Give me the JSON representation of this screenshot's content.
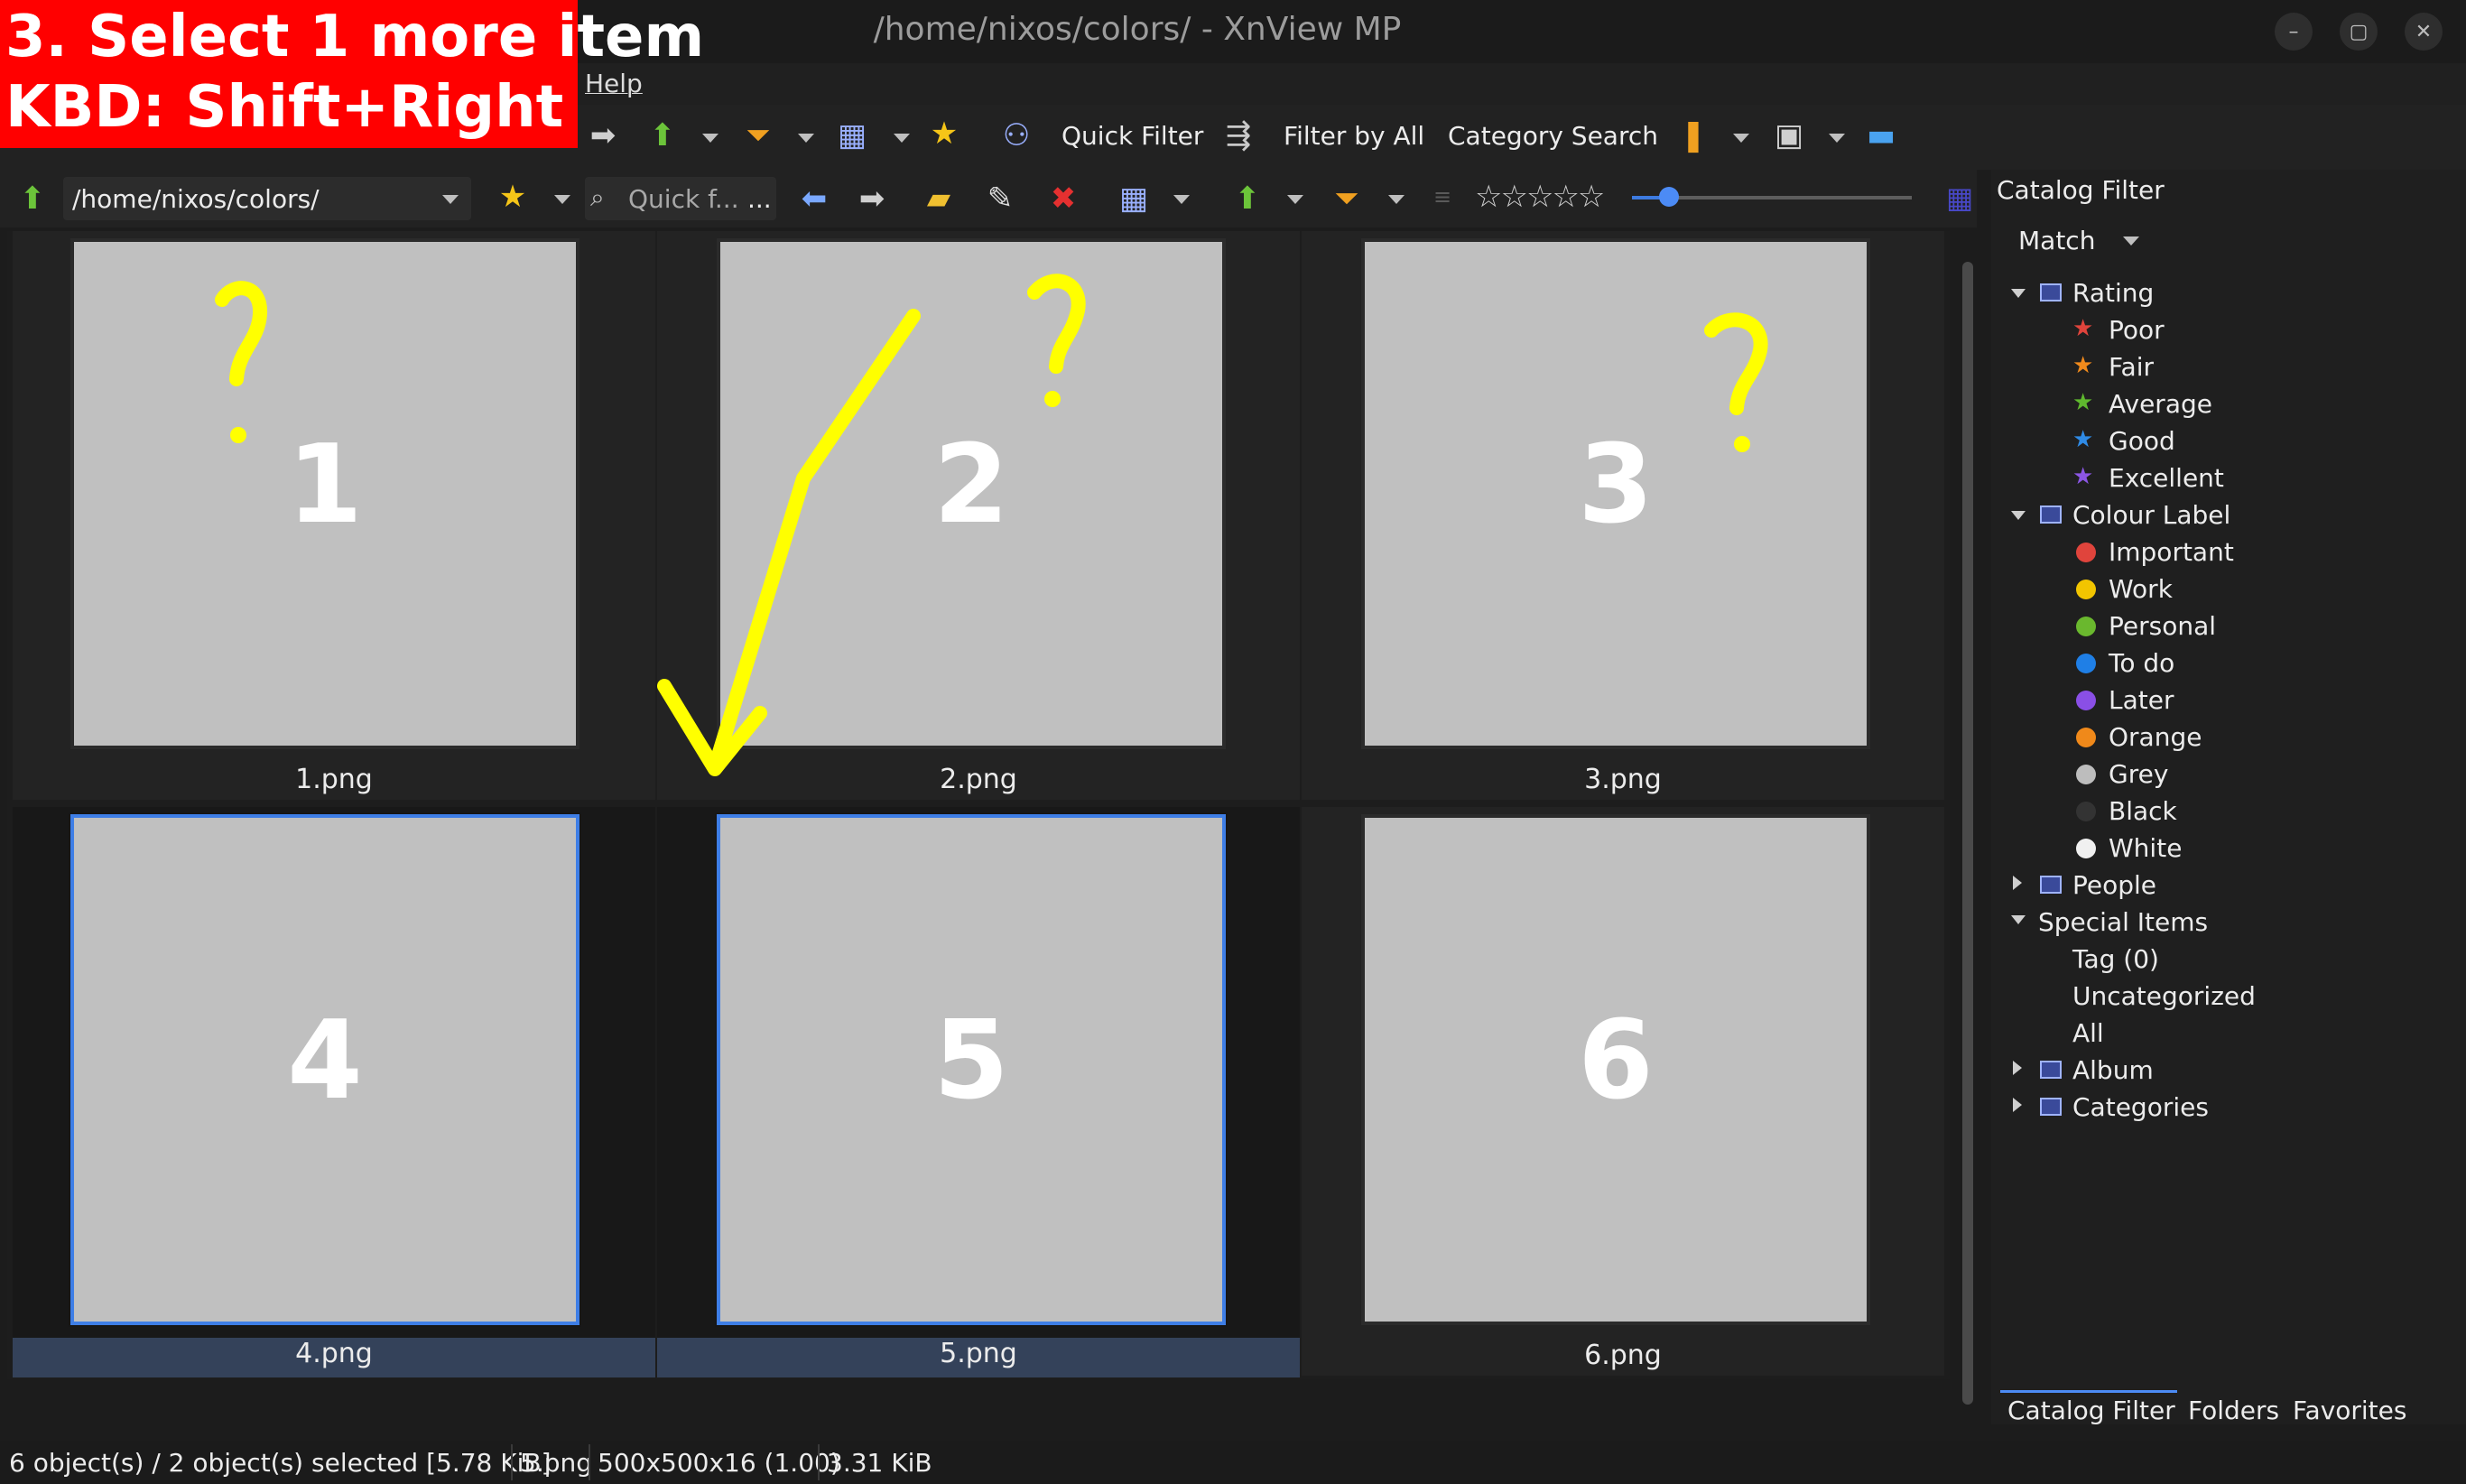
{
  "window": {
    "title": "/home/nixos/colors/ - XnView MP",
    "minimize": "–",
    "maximize": "▢",
    "close": "✕"
  },
  "menu": {
    "help": "Help"
  },
  "toolbar1": {
    "quick_filter": "Quick Filter",
    "filter_by_all": "Filter by All",
    "category_search": "Category Search"
  },
  "toolbar2": {
    "path": "/home/nixos/colors/",
    "quick_filter_placeholder": "Quick f...",
    "quick_filter_more": "...",
    "rating_stars": "☆☆☆☆☆"
  },
  "thumbnails": [
    {
      "number": "1",
      "filename": "1.png",
      "selected": false
    },
    {
      "number": "2",
      "filename": "2.png",
      "selected": false
    },
    {
      "number": "3",
      "filename": "3.png",
      "selected": false
    },
    {
      "number": "4",
      "filename": "4.png",
      "selected": true
    },
    {
      "number": "5",
      "filename": "5.png",
      "selected": true
    },
    {
      "number": "6",
      "filename": "6.png",
      "selected": false
    }
  ],
  "catalog": {
    "title": "Catalog Filter",
    "match": "Match",
    "rating": {
      "label": "Rating",
      "items": [
        "Poor",
        "Fair",
        "Average",
        "Good",
        "Excellent"
      ]
    },
    "colour_label": {
      "label": "Colour Label",
      "items": [
        "Important",
        "Work",
        "Personal",
        "To do",
        "Later",
        "Orange",
        "Grey",
        "Black",
        "White"
      ]
    },
    "people": "People",
    "special_items": {
      "label": "Special Items",
      "items": [
        "Tag (0)",
        "Uncategorized",
        "All"
      ]
    },
    "album": "Album",
    "categories": "Categories"
  },
  "colors": {
    "rating": [
      "#e0443c",
      "#f08a1c",
      "#5fb82e",
      "#2f8be6",
      "#8c56e6"
    ],
    "labels": [
      "#e0443c",
      "#f2c500",
      "#6ab82e",
      "#1f7fe6",
      "#8a4fe6",
      "#f0891a",
      "#bdbdbd",
      "#333333",
      "#f0f0f0"
    ],
    "accent": "#4c8bf5",
    "annotation": "#ff0000",
    "doodle": "#ffff00"
  },
  "tabs": [
    "Catalog Filter",
    "Folders",
    "Favorites"
  ],
  "status": {
    "objects": "6 object(s) / 2 object(s) selected [5.78 KiB]",
    "file": "5.png",
    "dims": "500x500x16 (1.00)",
    "size": "3.31 KiB"
  },
  "annotation": {
    "line1": "3. Select 1 more item",
    "line2": "KBD: Shift+Right"
  }
}
